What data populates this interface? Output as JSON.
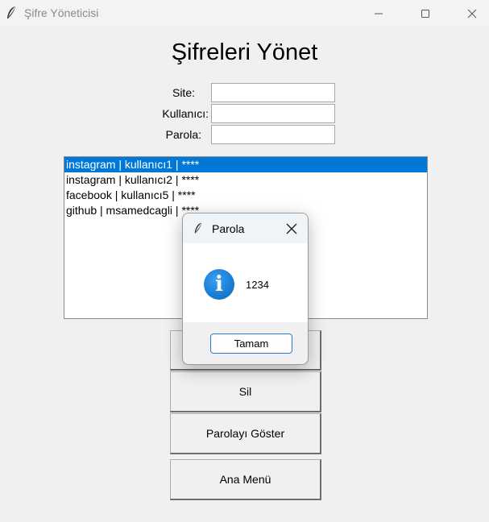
{
  "window": {
    "title": "Şifre Yöneticisi",
    "icons": {
      "app": "feather-icon",
      "minimize": "minimize-icon",
      "maximize": "maximize-icon",
      "close": "close-icon"
    }
  },
  "main": {
    "heading": "Şifreleri Yönet",
    "form": {
      "site_label": "Site:",
      "site_value": "",
      "user_label": "Kullanıcı:",
      "user_value": "",
      "password_label": "Parola:",
      "password_value": ""
    },
    "list": {
      "items": [
        {
          "text": "instagram | kullanıcı1 | ****",
          "selected": true
        },
        {
          "text": "instagram | kullanıcı2 | ****",
          "selected": false
        },
        {
          "text": "facebook | kullanıcı5 | ****",
          "selected": false
        },
        {
          "text": "github | msamedcagli | ****",
          "selected": false
        }
      ]
    },
    "buttons": {
      "delete_label": "Sil",
      "show_password_label": "Parolayı Göster",
      "main_menu_label": "Ana Menü"
    }
  },
  "dialog": {
    "title": "Parola",
    "message": "1234",
    "ok_label": "Tamam",
    "icon": "info-icon"
  },
  "colors": {
    "selection": "#0078d7",
    "dialog_ok_border": "#2a7ad2",
    "info_icon": "#1a7fd6",
    "window_bg": "#f0f0f0"
  }
}
